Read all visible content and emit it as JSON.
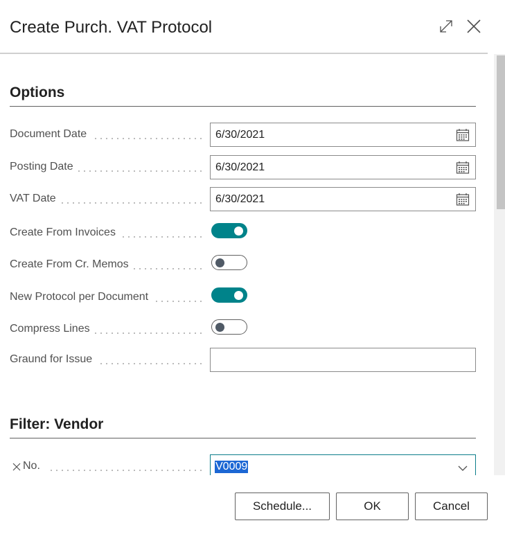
{
  "dialog": {
    "title": "Create Purch. VAT Protocol",
    "expand_icon": "expand-icon",
    "close_icon": "close-icon"
  },
  "options": {
    "title": "Options",
    "document_date": {
      "label": "Document Date",
      "value": "6/30/2021"
    },
    "posting_date": {
      "label": "Posting Date",
      "value": "6/30/2021"
    },
    "vat_date": {
      "label": "VAT Date",
      "value": "6/30/2021"
    },
    "create_from_invoices": {
      "label": "Create From Invoices",
      "on": true
    },
    "create_from_cr_memos": {
      "label": "Create From Cr. Memos",
      "on": false
    },
    "new_protocol_per_document": {
      "label": "New Protocol per Document",
      "on": true
    },
    "compress_lines": {
      "label": "Compress Lines",
      "on": false
    },
    "ground_for_issue": {
      "label": "Graund for Issue",
      "value": ""
    }
  },
  "filter_vendor": {
    "title": "Filter: Vendor",
    "no": {
      "label": "No.",
      "value": "V0009"
    }
  },
  "footer": {
    "schedule_label": "Schedule...",
    "ok_label": "OK",
    "cancel_label": "Cancel"
  },
  "colors": {
    "toggle_on": "#00838a",
    "toggle_off_knob": "#505a66",
    "selection": "#1c67d4"
  }
}
